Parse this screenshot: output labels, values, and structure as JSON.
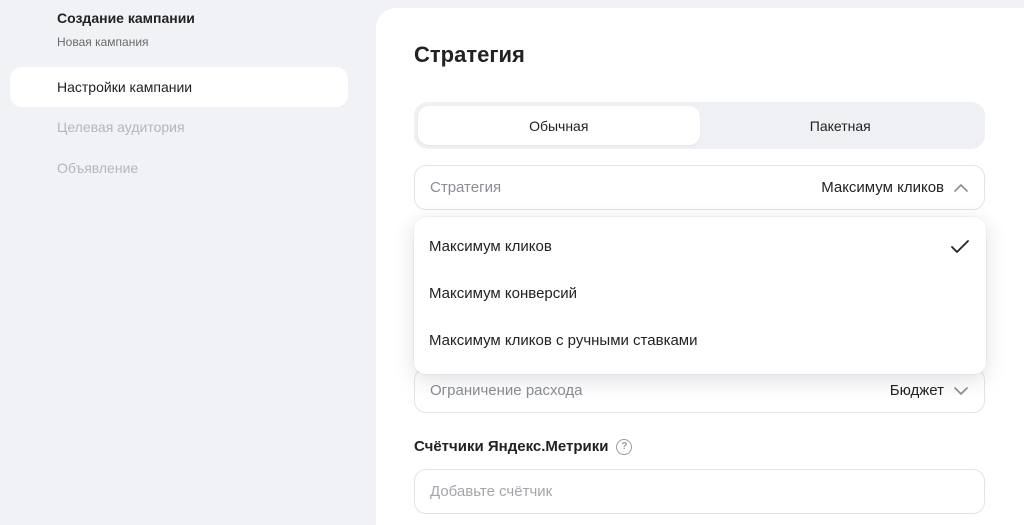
{
  "sidebar": {
    "title": "Создание кампании",
    "subtitle": "Новая кампания",
    "items": [
      {
        "label": "Настройки кампании",
        "active": true
      },
      {
        "label": "Целевая аудитория",
        "active": false
      },
      {
        "label": "Объявление",
        "active": false
      }
    ]
  },
  "main": {
    "title": "Стратегия",
    "tabs": [
      {
        "label": "Обычная",
        "active": true
      },
      {
        "label": "Пакетная",
        "active": false
      }
    ],
    "strategy_field": {
      "label": "Стратегия",
      "value": "Максимум кликов",
      "icon": "chevron-up-icon"
    },
    "dropdown_options": [
      {
        "label": "Максимум кликов",
        "selected": true
      },
      {
        "label": "Максимум конверсий",
        "selected": false
      },
      {
        "label": "Максимум кликов с ручными ставками",
        "selected": false
      }
    ],
    "spend_field": {
      "label": "Ограничение расхода",
      "value": "Бюджет",
      "icon": "chevron-down-icon"
    },
    "metrics": {
      "label": "Счётчики Яндекс.Метрики",
      "help_glyph": "?",
      "placeholder": "Добавьте счётчик"
    }
  },
  "colors": {
    "background": "#f1f2f5",
    "panel": "#ffffff",
    "muted_text": "#b3b6bc"
  }
}
